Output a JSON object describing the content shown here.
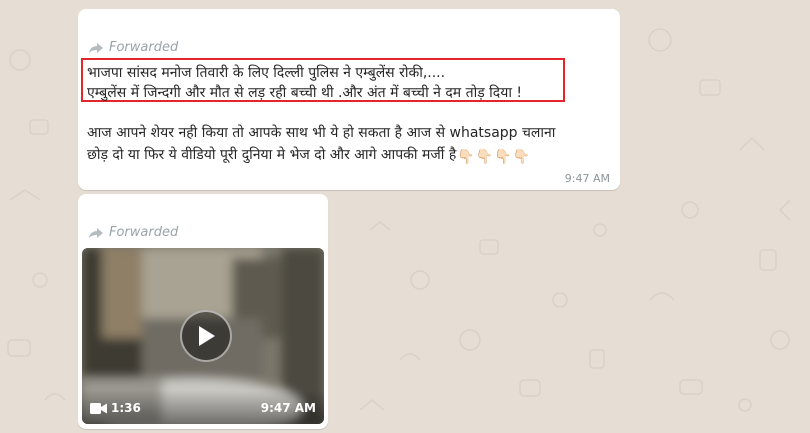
{
  "chat": {
    "messages": [
      {
        "forwarded_label": "Forwarded",
        "highlighted_lines": [
          "भाजपा सांसद मनोज तिवारी के लिए दिल्ली पुलिस ने एम्बुलेंस रोकी,....",
          "एम्बुलेंस में जिन्दगी और मौत से लड़ रही बच्ची थी .और अंत में बच्ची ने दम तोड़ दिया !"
        ],
        "body_lines": [
          "आज आपने शेयर नही किया तो आपके साथ भी ये हो सकता है आज से whatsapp चलाना",
          "छोड़ दो या फिर ये वीडियो पूरी दुनिया मे भेज दो और आगे  आपकी मर्जी है"
        ],
        "emoji": [
          "👇🏻",
          "👇🏻",
          "👇🏻",
          "👇🏻"
        ],
        "time": "9:47 AM"
      },
      {
        "forwarded_label": "Forwarded",
        "video": {
          "duration": "1:36",
          "time": "9:47 AM"
        }
      }
    ]
  },
  "icons": {
    "forward": "forward-arrow-icon",
    "play": "play-icon",
    "video": "video-camera-icon",
    "pointing": "pointing-down-hand-icon"
  },
  "colors": {
    "wallpaper": "#e6ddd4",
    "bubble": "#ffffff",
    "highlight_border": "#e3262b",
    "forwarded_text": "#9aa3a8",
    "timestamp": "#8d9599"
  }
}
